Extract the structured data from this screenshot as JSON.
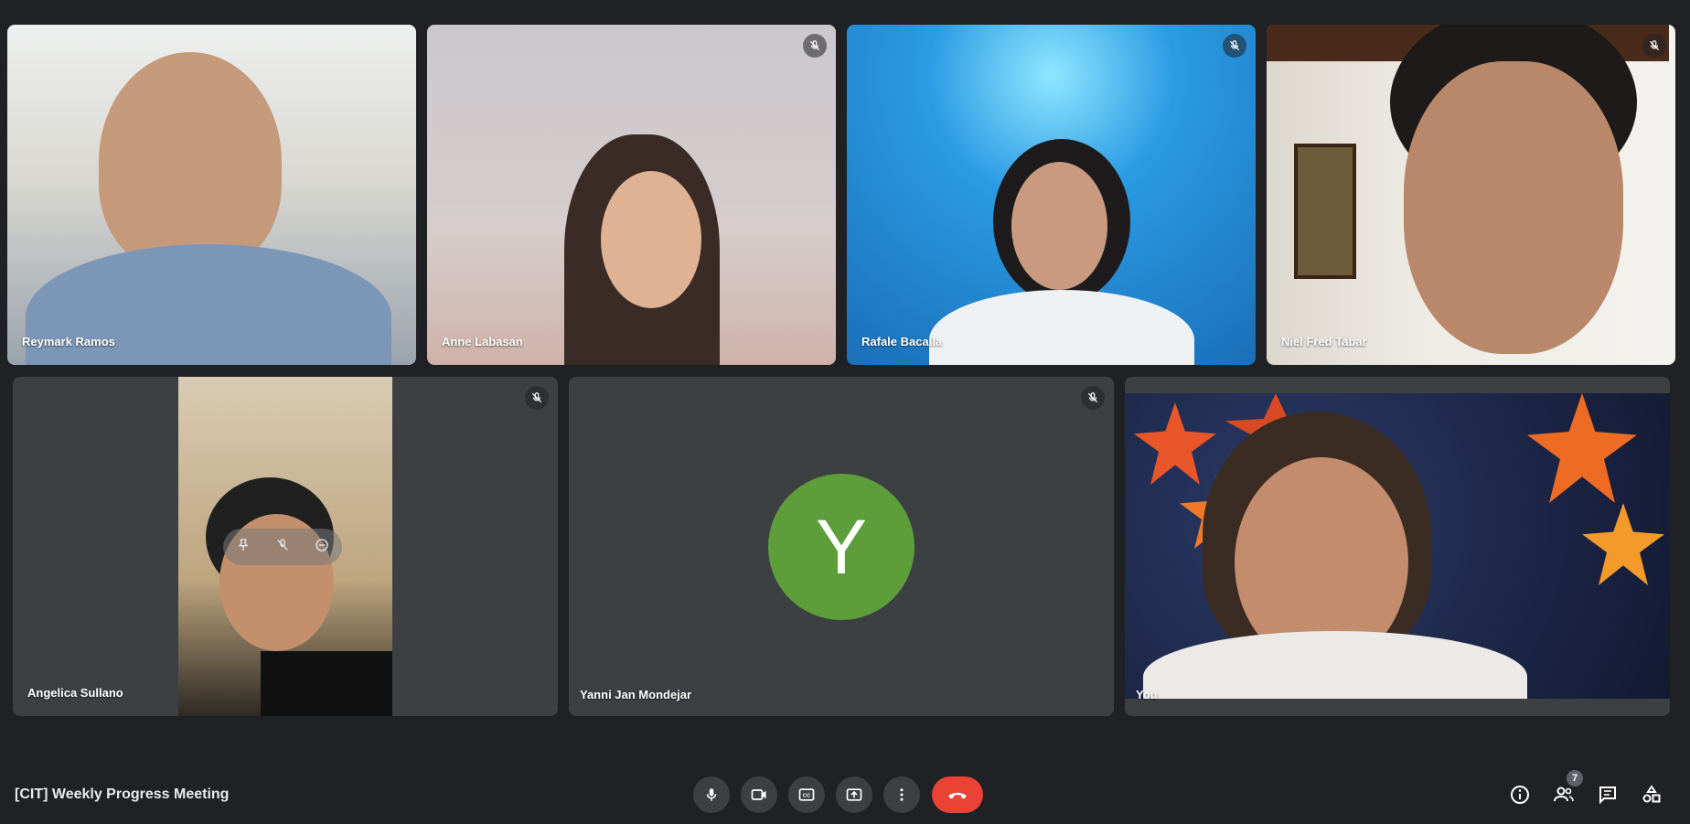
{
  "meeting": {
    "title": "[CIT] Weekly Progress Meeting"
  },
  "participants": [
    {
      "name": "Reymark Ramos",
      "muted": false
    },
    {
      "name": "Anne Labasan",
      "muted": true
    },
    {
      "name": "Rafale Bacalla",
      "muted": true
    },
    {
      "name": "Niel Fred Tabar",
      "muted": true
    },
    {
      "name": "Angelica Sullano",
      "muted": true
    },
    {
      "name": "Yanni Jan Mondejar",
      "muted": true,
      "avatar_letter": "Y",
      "avatar_color": "#5e9e3a"
    },
    {
      "name": "You",
      "muted": false
    }
  ],
  "controls": [
    "microphone",
    "camera",
    "captions",
    "present",
    "more-options",
    "leave-call"
  ],
  "right_controls": {
    "people_count": "7"
  },
  "colors": {
    "background": "#202124",
    "tile": "#3c4043",
    "hangup": "#ea4335"
  }
}
